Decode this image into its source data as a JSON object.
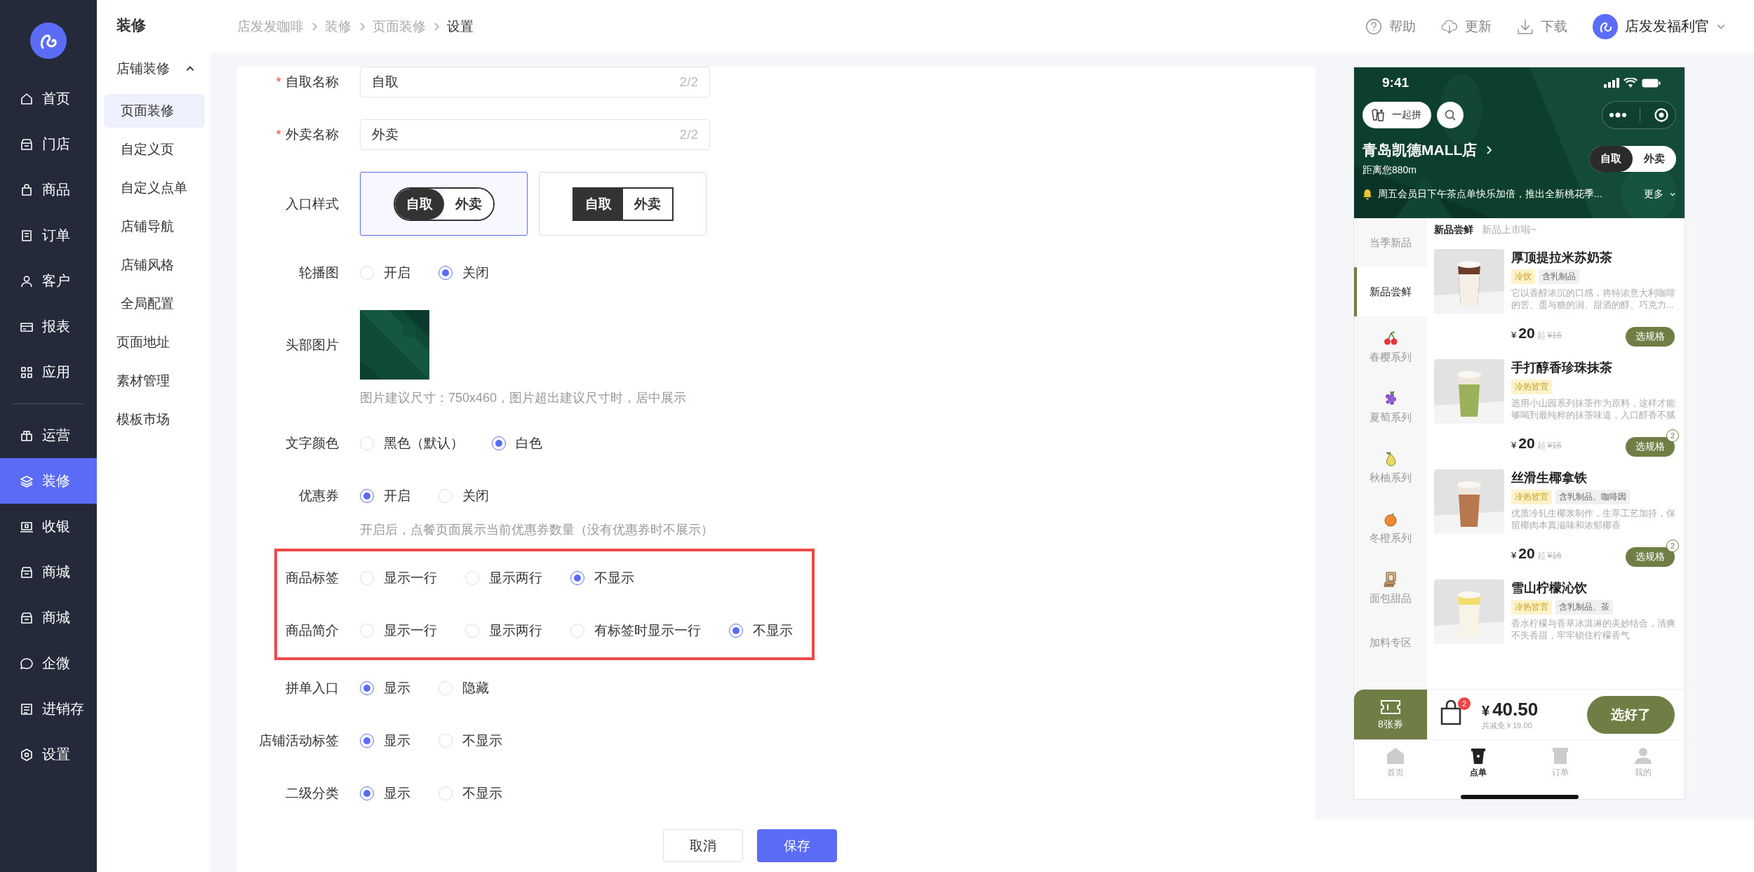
{
  "nav": {
    "primary": [
      {
        "label": "首页",
        "selected": false
      },
      {
        "label": "门店",
        "selected": false
      },
      {
        "label": "商品",
        "selected": false
      },
      {
        "label": "订单",
        "selected": false
      },
      {
        "label": "客户",
        "selected": false
      },
      {
        "label": "报表",
        "selected": false
      },
      {
        "label": "应用",
        "selected": false
      }
    ],
    "secondary": [
      {
        "label": "运营",
        "selected": false
      },
      {
        "label": "装修",
        "selected": true
      },
      {
        "label": "收银",
        "selected": false
      },
      {
        "label": "商城",
        "selected": false
      },
      {
        "label": "商城",
        "selected": false
      },
      {
        "label": "企微",
        "selected": false
      },
      {
        "label": "进销存",
        "selected": false
      },
      {
        "label": "设置",
        "selected": false
      }
    ]
  },
  "subnav": {
    "title": "装修",
    "items": [
      {
        "label": "店铺装修",
        "expanded": true,
        "selected": false,
        "children": [
          {
            "label": "页面装修",
            "selected": true
          },
          {
            "label": "自定义页",
            "selected": false
          },
          {
            "label": "自定义点单",
            "selected": false
          },
          {
            "label": "店铺导航",
            "selected": false
          },
          {
            "label": "店铺风格",
            "selected": false
          },
          {
            "label": "全局配置",
            "selected": false
          }
        ]
      },
      {
        "label": "页面地址",
        "selected": false
      },
      {
        "label": "素材管理",
        "selected": false
      },
      {
        "label": "模板市场",
        "selected": false
      }
    ]
  },
  "breadcrumb": [
    "店发发咖啡",
    "装修",
    "页面装修",
    "设置"
  ],
  "header_actions": [
    {
      "label": "帮助"
    },
    {
      "label": "更新"
    },
    {
      "label": "下载"
    }
  ],
  "user": {
    "name": "店发发福利官"
  },
  "form": {
    "rows": [
      {
        "kind": "text",
        "label": "自取名称",
        "required_mark": "*",
        "value": "自取",
        "count": "2/2"
      },
      {
        "kind": "text",
        "label": "外卖名称",
        "required_mark": "*",
        "value": "外卖",
        "count": "2/2"
      },
      {
        "kind": "style",
        "label": "入口样式",
        "options": [
          {
            "kind": "pill",
            "left": "自取",
            "right": "外卖",
            "selected": true
          },
          {
            "kind": "square",
            "left": "自取",
            "right": "外卖",
            "selected": false
          }
        ]
      },
      {
        "kind": "radio",
        "label": "轮播图",
        "options": [
          {
            "label": "开启",
            "selected": false
          },
          {
            "label": "关闭",
            "selected": true
          }
        ]
      },
      {
        "label": "头部图片",
        "hint": "图片建议尺寸：750x460，图片超出建议尺寸时，居中展示"
      },
      {
        "kind": "radio",
        "label": "文字颜色",
        "options": [
          {
            "label": "黑色（默认）",
            "selected": false
          },
          {
            "label": "白色",
            "selected": true
          }
        ]
      },
      {
        "kind": "radio",
        "label": "优惠券",
        "hint": "开启后，点餐页面展示当前优惠券数量（没有优惠券时不展示）",
        "options": [
          {
            "label": "开启",
            "selected": true
          },
          {
            "label": "关闭",
            "selected": false
          }
        ]
      },
      {
        "kind": "group",
        "highlighted": true,
        "rows": [
          {
            "kind": "radio",
            "label": "商品标签",
            "options": [
              {
                "label": "显示一行",
                "selected": false
              },
              {
                "label": "显示两行",
                "selected": false
              },
              {
                "label": "不显示",
                "selected": true
              }
            ]
          },
          {
            "kind": "radio",
            "label": "商品简介",
            "options": [
              {
                "label": "显示一行",
                "selected": false
              },
              {
                "label": "显示两行",
                "selected": false
              },
              {
                "label": "有标签时显示一行",
                "selected": false
              },
              {
                "label": "不显示",
                "selected": true
              }
            ]
          }
        ]
      },
      {
        "kind": "radio",
        "label": "拼单入口",
        "options": [
          {
            "label": "显示",
            "selected": true
          },
          {
            "label": "隐藏",
            "selected": false
          }
        ]
      },
      {
        "kind": "radio",
        "label": "店铺活动标签",
        "options": [
          {
            "label": "显示",
            "selected": true
          },
          {
            "label": "不显示",
            "selected": false
          }
        ]
      },
      {
        "kind": "radio",
        "label": "二级分类",
        "options": [
          {
            "label": "显示",
            "selected": true
          },
          {
            "label": "不显示",
            "selected": false
          }
        ]
      }
    ]
  },
  "footer": {
    "buttons": [
      {
        "label": "取消",
        "kind": "default"
      },
      {
        "label": "保存",
        "kind": "primary"
      }
    ]
  },
  "preview": {
    "time": "9:41",
    "group_buy": "一起拼",
    "store_name": "青岛凯德MALL店",
    "distance": "距离您880m",
    "mode_toggle": [
      {
        "label": "自取",
        "selected": true
      },
      {
        "label": "外卖",
        "selected": false
      }
    ],
    "notice": "周五会员日下午茶点单快乐加倍，推出全新桃花季...",
    "more": "更多",
    "categories": [
      {
        "label": "当季新品",
        "kind": "plain",
        "selected": false
      },
      {
        "label": "新品尝鲜",
        "kind": "plain",
        "selected": true
      },
      {
        "label": "春樱系列",
        "kind": "icon",
        "selected": false
      },
      {
        "label": "夏萄系列",
        "kind": "icon",
        "selected": false
      },
      {
        "label": "秋柚系列",
        "kind": "icon",
        "selected": false
      },
      {
        "label": "冬橙系列",
        "kind": "icon",
        "selected": false
      },
      {
        "label": "面包甜品",
        "kind": "icon",
        "selected": false
      },
      {
        "label": "加料专区",
        "kind": "plain",
        "selected": false
      }
    ],
    "section_title": "新品尝鲜",
    "section_subtitle": "新品上市啦~",
    "products": [
      {
        "name": "厚顶提拉米苏奶茶",
        "tags": [
          {
            "label": "冷饮",
            "kind": "temp"
          },
          {
            "label": "含乳制品",
            "kind": "info"
          }
        ],
        "desc": "它以香醇浓沉的口感，将特浓意大利咖啡的苦、蛋与糖的润、甜酒的醇、巧克力...",
        "currency": "¥",
        "price": "20",
        "suffix": "起",
        "original": "¥16",
        "button": "选规格"
      },
      {
        "name": "手打醇香珍珠抹茶",
        "tags": [
          {
            "label": "冷热皆宜",
            "kind": "temp"
          }
        ],
        "desc": "选用小山园系列抹茶作为原料，这样才能够喝到最纯粹的抹茶味道，入口醇香不腻",
        "currency": "¥",
        "price": "20",
        "suffix": "起",
        "original": "¥16",
        "button": "选规格",
        "badge": "2"
      },
      {
        "name": "丝滑生椰拿铁",
        "tags": [
          {
            "label": "冷热皆宜",
            "kind": "temp"
          },
          {
            "label": "含乳制品、咖啡因",
            "kind": "info"
          }
        ],
        "desc": "优质冷轧生椰浆制作，生萃工艺加持，保留椰肉本真滋味和浓郁椰香",
        "currency": "¥",
        "price": "20",
        "suffix": "起",
        "original": "¥16",
        "button": "选规格",
        "badge": "2"
      },
      {
        "name": "雪山柠檬沁饮",
        "tags": [
          {
            "label": "冷热皆宜",
            "kind": "temp"
          },
          {
            "label": "含乳制品、茶",
            "kind": "info"
          }
        ],
        "desc": "香水柠檬与香草冰淇淋的美妙结合，清爽不失香甜，牢牢锁住柠檬香气"
      }
    ],
    "cart": {
      "coupons": "8张券",
      "count": "2",
      "currency": "¥",
      "total": "40.50",
      "saving": "共减免￥19.00",
      "button": "选好了"
    },
    "tabbar": [
      {
        "label": "首页",
        "selected": false
      },
      {
        "label": "点单",
        "selected": true
      },
      {
        "label": "订单",
        "selected": false
      },
      {
        "label": "我的",
        "selected": false
      }
    ]
  }
}
